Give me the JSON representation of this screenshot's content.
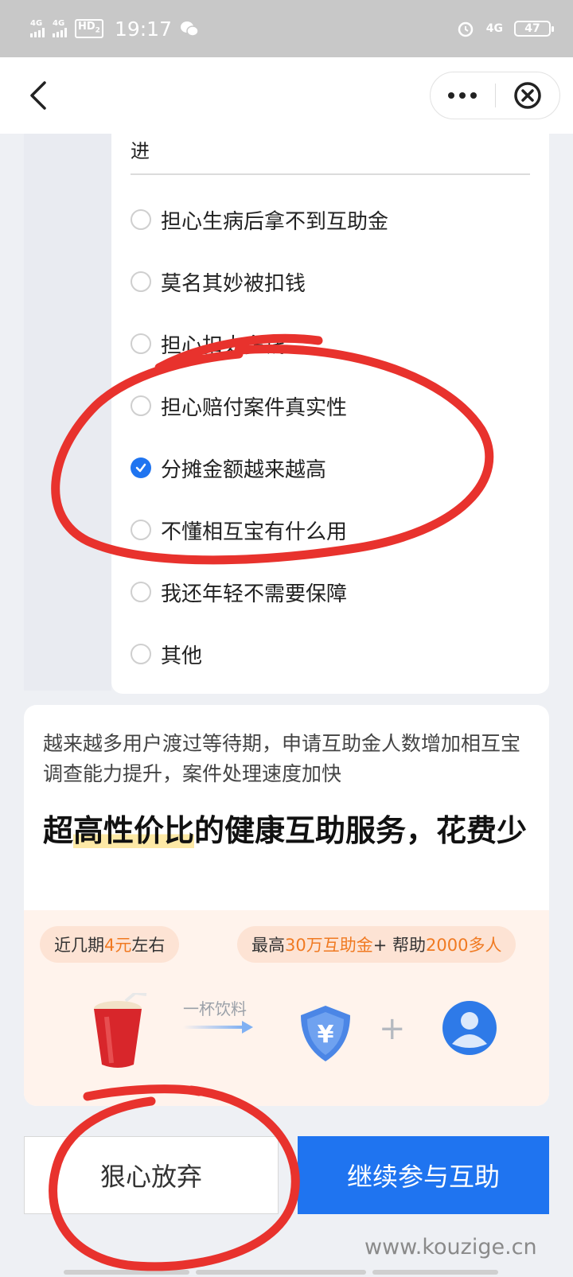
{
  "status_bar": {
    "signal1": "4G",
    "signal2": "4G",
    "hd": "HD",
    "hd_sub": "2",
    "time": "19:17",
    "net": "4G",
    "battery": "47"
  },
  "nav": {
    "back_icon": "chevron-left-icon",
    "more_icon": "more-dots-icon",
    "close_icon": "close-circle-icon"
  },
  "survey": {
    "prev_text": "进",
    "options": [
      {
        "label": "担心生病后拿不到互助金",
        "checked": false
      },
      {
        "label": "莫名其妙被扣钱",
        "checked": false
      },
      {
        "label": "担心扣太多钱",
        "checked": false
      },
      {
        "label": "担心赔付案件真实性",
        "checked": false
      },
      {
        "label": "分摊金额越来越高",
        "checked": true
      },
      {
        "label": "不懂相互宝有什么用",
        "checked": false
      },
      {
        "label": "我还年轻不需要保障",
        "checked": false
      },
      {
        "label": "其他",
        "checked": false
      }
    ]
  },
  "info": {
    "subtitle": "越来越多用户渡过等待期，申请互助金人数增加相互宝调查能力提升，案件处理速度加快",
    "title_pre": "超",
    "title_hl": "高性价比",
    "title_post": "的健康互助服务，花费少",
    "pill_left": {
      "pre": "近几期",
      "accent": "4元",
      "post": "左右"
    },
    "pill_right": {
      "pre": "最高",
      "accent1": "30万互助金",
      "mid": " + 帮助",
      "accent2": "2000多人"
    },
    "drink_caption": "一杯饮料",
    "plus": "+"
  },
  "buttons": {
    "abandon": "狠心放弃",
    "continue": "继续参与互助"
  },
  "watermark": "www.kouzige.cn",
  "colors": {
    "primary": "#1f74f0",
    "accent": "#f07a22",
    "annotation": "#e8322d"
  }
}
